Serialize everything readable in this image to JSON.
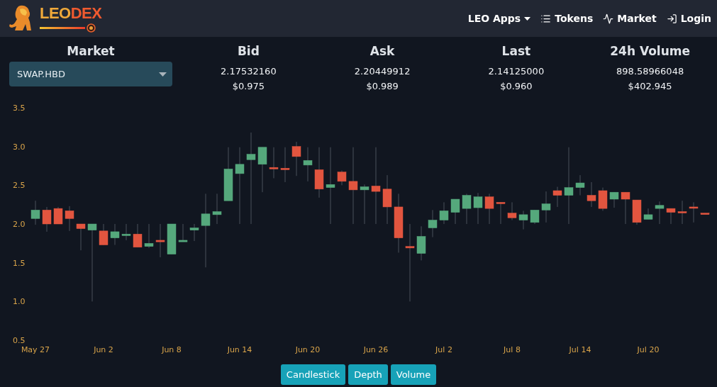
{
  "header": {
    "logo": {
      "parts": [
        "LEO",
        "DEX"
      ]
    },
    "nav": [
      {
        "label": "LEO Apps",
        "kind": "dropdown"
      },
      {
        "label": "Tokens",
        "kind": "tokens"
      },
      {
        "label": "Market",
        "kind": "market"
      },
      {
        "label": "Login",
        "kind": "login"
      }
    ]
  },
  "stats": [
    {
      "heading": "Market",
      "kind": "select",
      "value": "SWAP.HBD"
    },
    {
      "heading": "Bid",
      "kind": "price",
      "value": "2.17532160",
      "usd": "$0.975"
    },
    {
      "heading": "Ask",
      "kind": "price",
      "value": "2.20449912",
      "usd": "$0.989"
    },
    {
      "heading": "Last",
      "kind": "price",
      "value": "2.14125000",
      "usd": "$0.960"
    },
    {
      "heading": "24h Volume",
      "kind": "price",
      "value": "898.58966048",
      "usd": "$402.945"
    }
  ],
  "chart": {
    "chart_data": {
      "type": "candlestick",
      "ylim": [
        0.5,
        3.5
      ],
      "yticks": [
        {
          "value": 0.5,
          "label": "0.5"
        },
        {
          "value": 1,
          "label": "1.0"
        },
        {
          "value": 1.5,
          "label": "1.5"
        },
        {
          "value": 2,
          "label": "2.0"
        },
        {
          "value": 2.5,
          "label": "2.5"
        },
        {
          "value": 3,
          "label": "3.0"
        },
        {
          "value": 3.5,
          "label": "3.5"
        }
      ],
      "categories": [
        "May 27",
        null,
        null,
        null,
        null,
        null,
        "Jun 2",
        null,
        null,
        null,
        null,
        null,
        "Jun 8",
        null,
        null,
        null,
        null,
        null,
        "Jun 14",
        null,
        null,
        null,
        null,
        null,
        "Jun 20",
        null,
        null,
        null,
        null,
        null,
        "Jun 26",
        null,
        null,
        null,
        null,
        null,
        "Jul 2",
        null,
        null,
        null,
        null,
        null,
        "Jul 8",
        null,
        null,
        null,
        null,
        null,
        "Jul 14",
        null,
        null,
        null,
        null,
        null,
        "Jul 20",
        null,
        null,
        null,
        null,
        null
      ],
      "ohlc": [
        [
          2.07,
          2.3,
          1.99,
          2.18
        ],
        [
          2.18,
          2.22,
          1.9,
          2.0
        ],
        [
          2.2,
          2.22,
          2.0,
          2.0
        ],
        [
          2.17,
          2.23,
          1.91,
          2.07
        ],
        [
          2.0,
          2.0,
          1.66,
          1.94
        ],
        [
          1.92,
          2.0,
          1.0,
          2.0
        ],
        [
          1.91,
          2.0,
          1.73,
          1.73
        ],
        [
          1.82,
          2.0,
          1.73,
          1.9
        ],
        [
          1.85,
          2.0,
          1.79,
          1.87
        ],
        [
          1.87,
          2.0,
          1.7,
          1.7
        ],
        [
          1.71,
          2.0,
          1.69,
          1.75
        ],
        [
          1.79,
          2.0,
          1.57,
          1.77
        ],
        [
          1.61,
          2.0,
          1.61,
          2.0
        ],
        [
          1.77,
          2.0,
          1.77,
          1.79
        ],
        [
          1.92,
          2.0,
          1.78,
          1.95
        ],
        [
          1.98,
          2.39,
          1.44,
          2.13
        ],
        [
          2.12,
          2.39,
          2.0,
          2.16
        ],
        [
          2.3,
          2.99,
          2.3,
          2.71
        ],
        [
          2.65,
          2.99,
          2.0,
          2.77
        ],
        [
          2.83,
          3.18,
          2.0,
          2.9
        ],
        [
          2.77,
          2.99,
          2.41,
          2.99
        ],
        [
          2.73,
          2.99,
          2.59,
          2.71
        ],
        [
          2.72,
          2.99,
          2.54,
          2.7
        ],
        [
          3.0,
          3.06,
          2.62,
          2.87
        ],
        [
          2.76,
          2.99,
          2.55,
          2.82
        ],
        [
          2.7,
          2.99,
          2.34,
          2.45
        ],
        [
          2.47,
          2.99,
          2.0,
          2.51
        ],
        [
          2.67,
          2.69,
          2.5,
          2.55
        ],
        [
          2.55,
          2.99,
          2.0,
          2.44
        ],
        [
          2.44,
          2.51,
          2.0,
          2.48
        ],
        [
          2.49,
          2.99,
          2.0,
          2.42
        ],
        [
          2.45,
          2.63,
          2.0,
          2.22
        ],
        [
          2.22,
          2.39,
          1.63,
          1.82
        ],
        [
          1.71,
          2.0,
          1.0,
          1.69
        ],
        [
          1.62,
          1.97,
          1.53,
          1.84
        ],
        [
          1.95,
          2.18,
          1.83,
          2.05
        ],
        [
          2.05,
          2.28,
          2.0,
          2.17
        ],
        [
          2.15,
          2.32,
          2.0,
          2.32
        ],
        [
          2.2,
          2.39,
          2.0,
          2.37
        ],
        [
          2.21,
          2.4,
          2.0,
          2.35
        ],
        [
          2.35,
          2.39,
          2.0,
          2.2
        ],
        [
          2.28,
          2.28,
          2.0,
          2.27
        ],
        [
          2.14,
          2.28,
          2.05,
          2.08
        ],
        [
          2.05,
          2.17,
          1.93,
          2.12
        ],
        [
          2.02,
          2.18,
          2.0,
          2.18
        ],
        [
          2.18,
          2.42,
          2.02,
          2.26
        ],
        [
          2.43,
          2.48,
          2.22,
          2.37
        ],
        [
          2.37,
          2.99,
          2.0,
          2.47
        ],
        [
          2.47,
          2.63,
          2.37,
          2.53
        ],
        [
          2.37,
          2.54,
          2.22,
          2.3
        ],
        [
          2.43,
          2.47,
          2.17,
          2.2
        ],
        [
          2.32,
          2.41,
          2.21,
          2.41
        ],
        [
          2.41,
          2.41,
          2.0,
          2.32
        ],
        [
          2.31,
          2.31,
          1.99,
          2.02
        ],
        [
          2.06,
          2.2,
          2.06,
          2.12
        ],
        [
          2.2,
          2.29,
          2.0,
          2.24
        ],
        [
          2.2,
          2.2,
          2.0,
          2.15
        ],
        [
          2.16,
          2.3,
          2.0,
          2.15
        ],
        [
          2.22,
          2.28,
          2.02,
          2.21
        ],
        [
          2.14,
          2.14,
          2.13,
          2.13
        ]
      ]
    }
  },
  "chart_buttons": [
    {
      "label": "Candlestick"
    },
    {
      "label": "Depth"
    },
    {
      "label": "Volume"
    }
  ]
}
